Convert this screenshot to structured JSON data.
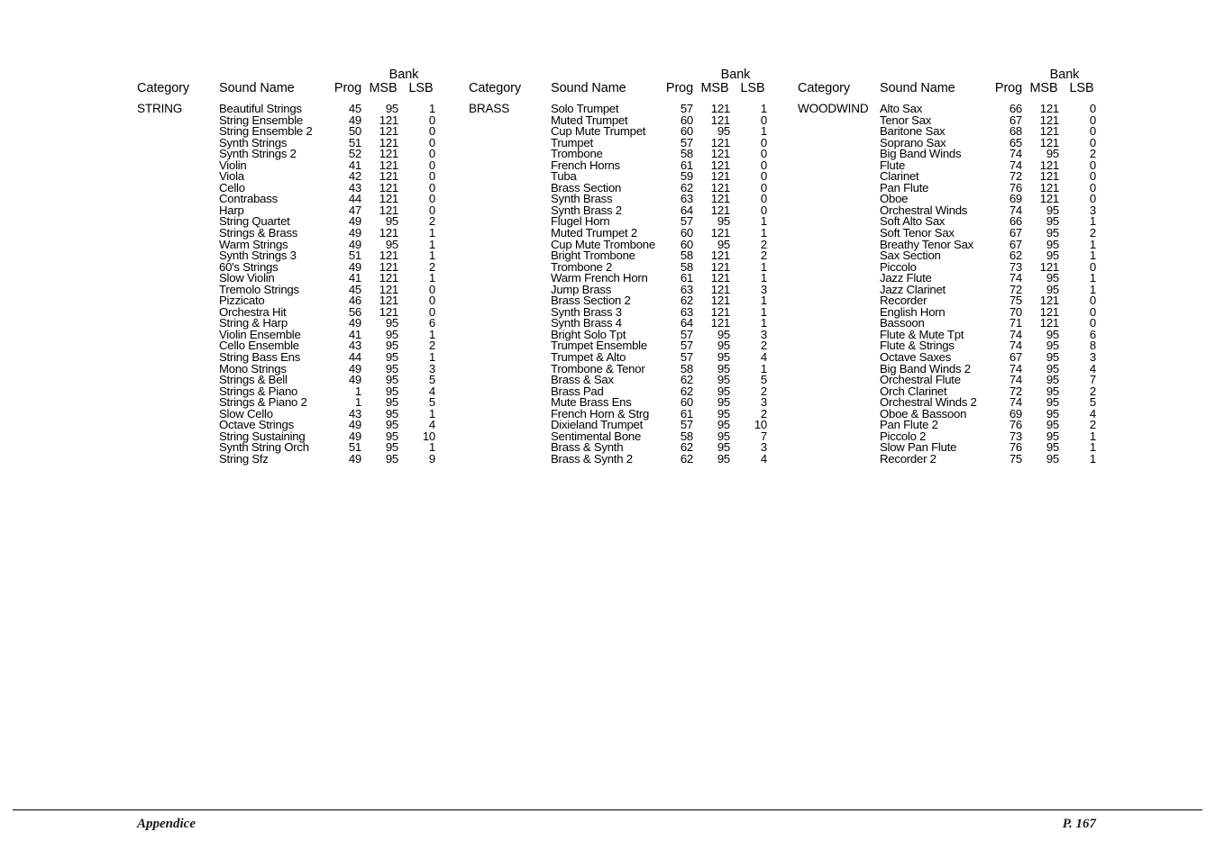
{
  "page": {
    "background": "#ffffff",
    "text_color": "#000000"
  },
  "columns": {
    "category": "Category",
    "sound_name": "Sound Name",
    "prog": "Prog",
    "bank": "Bank",
    "msb": "MSB",
    "lsb": "LSB"
  },
  "groups": [
    {
      "category": "STRING",
      "headers": {
        "category": "Category",
        "sound_name": "Sound Name",
        "prog": "Prog",
        "bank": "Bank",
        "msb": "MSB",
        "lsb": "LSB"
      },
      "rows": [
        {
          "name": "Beautiful Strings",
          "prog": "45",
          "msb": "95",
          "lsb": "1"
        },
        {
          "name": "String Ensemble",
          "prog": "49",
          "msb": "121",
          "lsb": "0"
        },
        {
          "name": "String Ensemble 2",
          "prog": "50",
          "msb": "121",
          "lsb": "0"
        },
        {
          "name": "Synth Strings",
          "prog": "51",
          "msb": "121",
          "lsb": "0"
        },
        {
          "name": "Synth Strings 2",
          "prog": "52",
          "msb": "121",
          "lsb": "0"
        },
        {
          "name": "Violin",
          "prog": "41",
          "msb": "121",
          "lsb": "0"
        },
        {
          "name": "Viola",
          "prog": "42",
          "msb": "121",
          "lsb": "0"
        },
        {
          "name": "Cello",
          "prog": "43",
          "msb": "121",
          "lsb": "0"
        },
        {
          "name": "Contrabass",
          "prog": "44",
          "msb": "121",
          "lsb": "0"
        },
        {
          "name": "Harp",
          "prog": "47",
          "msb": "121",
          "lsb": "0"
        },
        {
          "name": "String Quartet",
          "prog": "49",
          "msb": "95",
          "lsb": "2"
        },
        {
          "name": "Strings & Brass",
          "prog": "49",
          "msb": "121",
          "lsb": "1"
        },
        {
          "name": "Warm Strings",
          "prog": "49",
          "msb": "95",
          "lsb": "1"
        },
        {
          "name": "Synth Strings 3",
          "prog": "51",
          "msb": "121",
          "lsb": "1"
        },
        {
          "name": "60's Strings",
          "prog": "49",
          "msb": "121",
          "lsb": "2"
        },
        {
          "name": "Slow Violin",
          "prog": "41",
          "msb": "121",
          "lsb": "1"
        },
        {
          "name": "Tremolo Strings",
          "prog": "45",
          "msb": "121",
          "lsb": "0"
        },
        {
          "name": "Pizzicato",
          "prog": "46",
          "msb": "121",
          "lsb": "0"
        },
        {
          "name": "Orchestra Hit",
          "prog": "56",
          "msb": "121",
          "lsb": "0"
        },
        {
          "name": "String & Harp",
          "prog": "49",
          "msb": "95",
          "lsb": "6"
        },
        {
          "name": "Violin Ensemble",
          "prog": "41",
          "msb": "95",
          "lsb": "1"
        },
        {
          "name": "Cello Ensemble",
          "prog": "43",
          "msb": "95",
          "lsb": "2"
        },
        {
          "name": "String Bass Ens",
          "prog": "44",
          "msb": "95",
          "lsb": "1"
        },
        {
          "name": "Mono Strings",
          "prog": "49",
          "msb": "95",
          "lsb": "3"
        },
        {
          "name": "Strings & Bell",
          "prog": "49",
          "msb": "95",
          "lsb": "5"
        },
        {
          "name": "Strings & Piano",
          "prog": "1",
          "msb": "95",
          "lsb": "4"
        },
        {
          "name": "Strings & Piano 2",
          "prog": "1",
          "msb": "95",
          "lsb": "5"
        },
        {
          "name": "Slow Cello",
          "prog": "43",
          "msb": "95",
          "lsb": "1"
        },
        {
          "name": "Octave Strings",
          "prog": "49",
          "msb": "95",
          "lsb": "4"
        },
        {
          "name": "String Sustaining",
          "prog": "49",
          "msb": "95",
          "lsb": "10"
        },
        {
          "name": "Synth String Orch",
          "prog": "51",
          "msb": "95",
          "lsb": "1"
        },
        {
          "name": "String Sfz",
          "prog": "49",
          "msb": "95",
          "lsb": "9"
        }
      ]
    },
    {
      "category": "BRASS",
      "headers": {
        "category": "Category",
        "sound_name": "Sound Name",
        "prog": "Prog",
        "bank": "Bank",
        "msb": "MSB",
        "lsb": "LSB"
      },
      "rows": [
        {
          "name": "Solo Trumpet",
          "prog": "57",
          "msb": "121",
          "lsb": "1"
        },
        {
          "name": "Muted Trumpet",
          "prog": "60",
          "msb": "121",
          "lsb": "0"
        },
        {
          "name": "Cup Mute Trumpet",
          "prog": "60",
          "msb": "95",
          "lsb": "1"
        },
        {
          "name": "Trumpet",
          "prog": "57",
          "msb": "121",
          "lsb": "0"
        },
        {
          "name": "Trombone",
          "prog": "58",
          "msb": "121",
          "lsb": "0"
        },
        {
          "name": "French Horns",
          "prog": "61",
          "msb": "121",
          "lsb": "0"
        },
        {
          "name": "Tuba",
          "prog": "59",
          "msb": "121",
          "lsb": "0"
        },
        {
          "name": "Brass Section",
          "prog": "62",
          "msb": "121",
          "lsb": "0"
        },
        {
          "name": "Synth Brass",
          "prog": "63",
          "msb": "121",
          "lsb": "0"
        },
        {
          "name": "Synth Brass 2",
          "prog": "64",
          "msb": "121",
          "lsb": "0"
        },
        {
          "name": "Flugel Horn",
          "prog": "57",
          "msb": "95",
          "lsb": "1"
        },
        {
          "name": "Muted Trumpet 2",
          "prog": "60",
          "msb": "121",
          "lsb": "1"
        },
        {
          "name": "Cup Mute Trombone",
          "prog": "60",
          "msb": "95",
          "lsb": "2"
        },
        {
          "name": "Bright Trombone",
          "prog": "58",
          "msb": "121",
          "lsb": "2"
        },
        {
          "name": "Trombone 2",
          "prog": "58",
          "msb": "121",
          "lsb": "1"
        },
        {
          "name": "Warm French Horn",
          "prog": "61",
          "msb": "121",
          "lsb": "1"
        },
        {
          "name": "Jump Brass",
          "prog": "63",
          "msb": "121",
          "lsb": "3"
        },
        {
          "name": "Brass Section 2",
          "prog": "62",
          "msb": "121",
          "lsb": "1"
        },
        {
          "name": "Synth Brass 3",
          "prog": "63",
          "msb": "121",
          "lsb": "1"
        },
        {
          "name": "Synth Brass 4",
          "prog": "64",
          "msb": "121",
          "lsb": "1"
        },
        {
          "name": "Bright Solo Tpt",
          "prog": "57",
          "msb": "95",
          "lsb": "3"
        },
        {
          "name": "Trumpet Ensemble",
          "prog": "57",
          "msb": "95",
          "lsb": "2"
        },
        {
          "name": "Trumpet & Alto",
          "prog": "57",
          "msb": "95",
          "lsb": "4"
        },
        {
          "name": "Trombone & Tenor",
          "prog": "58",
          "msb": "95",
          "lsb": "1"
        },
        {
          "name": "Brass & Sax",
          "prog": "62",
          "msb": "95",
          "lsb": "5"
        },
        {
          "name": "Brass Pad",
          "prog": "62",
          "msb": "95",
          "lsb": "2"
        },
        {
          "name": "Mute Brass Ens",
          "prog": "60",
          "msb": "95",
          "lsb": "3"
        },
        {
          "name": "French Horn & Strg",
          "prog": "61",
          "msb": "95",
          "lsb": "2"
        },
        {
          "name": "Dixieland Trumpet",
          "prog": "57",
          "msb": "95",
          "lsb": "10"
        },
        {
          "name": "Sentimental Bone",
          "prog": "58",
          "msb": "95",
          "lsb": "7"
        },
        {
          "name": "Brass & Synth",
          "prog": "62",
          "msb": "95",
          "lsb": "3"
        },
        {
          "name": "Brass & Synth 2",
          "prog": "62",
          "msb": "95",
          "lsb": "4"
        }
      ]
    },
    {
      "category": "WOODWIND",
      "headers": {
        "category": "Category",
        "sound_name": "Sound Name",
        "prog": "Prog",
        "bank": "Bank",
        "msb": "MSB",
        "lsb": "LSB"
      },
      "rows": [
        {
          "name": "Alto Sax",
          "prog": "66",
          "msb": "121",
          "lsb": "0"
        },
        {
          "name": "Tenor Sax",
          "prog": "67",
          "msb": "121",
          "lsb": "0"
        },
        {
          "name": "Baritone Sax",
          "prog": "68",
          "msb": "121",
          "lsb": "0"
        },
        {
          "name": "Soprano Sax",
          "prog": "65",
          "msb": "121",
          "lsb": "0"
        },
        {
          "name": "Big Band Winds",
          "prog": "74",
          "msb": "95",
          "lsb": "2"
        },
        {
          "name": "Flute",
          "prog": "74",
          "msb": "121",
          "lsb": "0"
        },
        {
          "name": "Clarinet",
          "prog": "72",
          "msb": "121",
          "lsb": "0"
        },
        {
          "name": "Pan Flute",
          "prog": "76",
          "msb": "121",
          "lsb": "0"
        },
        {
          "name": "Oboe",
          "prog": "69",
          "msb": "121",
          "lsb": "0"
        },
        {
          "name": "Orchestral Winds",
          "prog": "74",
          "msb": "95",
          "lsb": "3"
        },
        {
          "name": "Soft Alto Sax",
          "prog": "66",
          "msb": "95",
          "lsb": "1"
        },
        {
          "name": "Soft Tenor Sax",
          "prog": "67",
          "msb": "95",
          "lsb": "2"
        },
        {
          "name": "Breathy Tenor Sax",
          "prog": "67",
          "msb": "95",
          "lsb": "1"
        },
        {
          "name": "Sax Section",
          "prog": "62",
          "msb": "95",
          "lsb": "1"
        },
        {
          "name": "Piccolo",
          "prog": "73",
          "msb": "121",
          "lsb": "0"
        },
        {
          "name": "Jazz Flute",
          "prog": "74",
          "msb": "95",
          "lsb": "1"
        },
        {
          "name": "Jazz Clarinet",
          "prog": "72",
          "msb": "95",
          "lsb": "1"
        },
        {
          "name": "Recorder",
          "prog": "75",
          "msb": "121",
          "lsb": "0"
        },
        {
          "name": "English Horn",
          "prog": "70",
          "msb": "121",
          "lsb": "0"
        },
        {
          "name": "Bassoon",
          "prog": "71",
          "msb": "121",
          "lsb": "0"
        },
        {
          "name": "Flute & Mute Tpt",
          "prog": "74",
          "msb": "95",
          "lsb": "6"
        },
        {
          "name": "Flute & Strings",
          "prog": "74",
          "msb": "95",
          "lsb": "8"
        },
        {
          "name": "Octave Saxes",
          "prog": "67",
          "msb": "95",
          "lsb": "3"
        },
        {
          "name": "Big Band Winds 2",
          "prog": "74",
          "msb": "95",
          "lsb": "4"
        },
        {
          "name": "Orchestral Flute",
          "prog": "74",
          "msb": "95",
          "lsb": "7"
        },
        {
          "name": "Orch Clarinet",
          "prog": "72",
          "msb": "95",
          "lsb": "2"
        },
        {
          "name": "Orchestral Winds 2",
          "prog": "74",
          "msb": "95",
          "lsb": "5"
        },
        {
          "name": "Oboe & Bassoon",
          "prog": "69",
          "msb": "95",
          "lsb": "4"
        },
        {
          "name": "Pan Flute 2",
          "prog": "76",
          "msb": "95",
          "lsb": "2"
        },
        {
          "name": "Piccolo 2",
          "prog": "73",
          "msb": "95",
          "lsb": "1"
        },
        {
          "name": "Slow Pan Flute",
          "prog": "76",
          "msb": "95",
          "lsb": "1"
        },
        {
          "name": "Recorder 2",
          "prog": "75",
          "msb": "95",
          "lsb": "1"
        }
      ]
    }
  ],
  "footer": {
    "left": "Appendice",
    "right": "P. 167"
  }
}
